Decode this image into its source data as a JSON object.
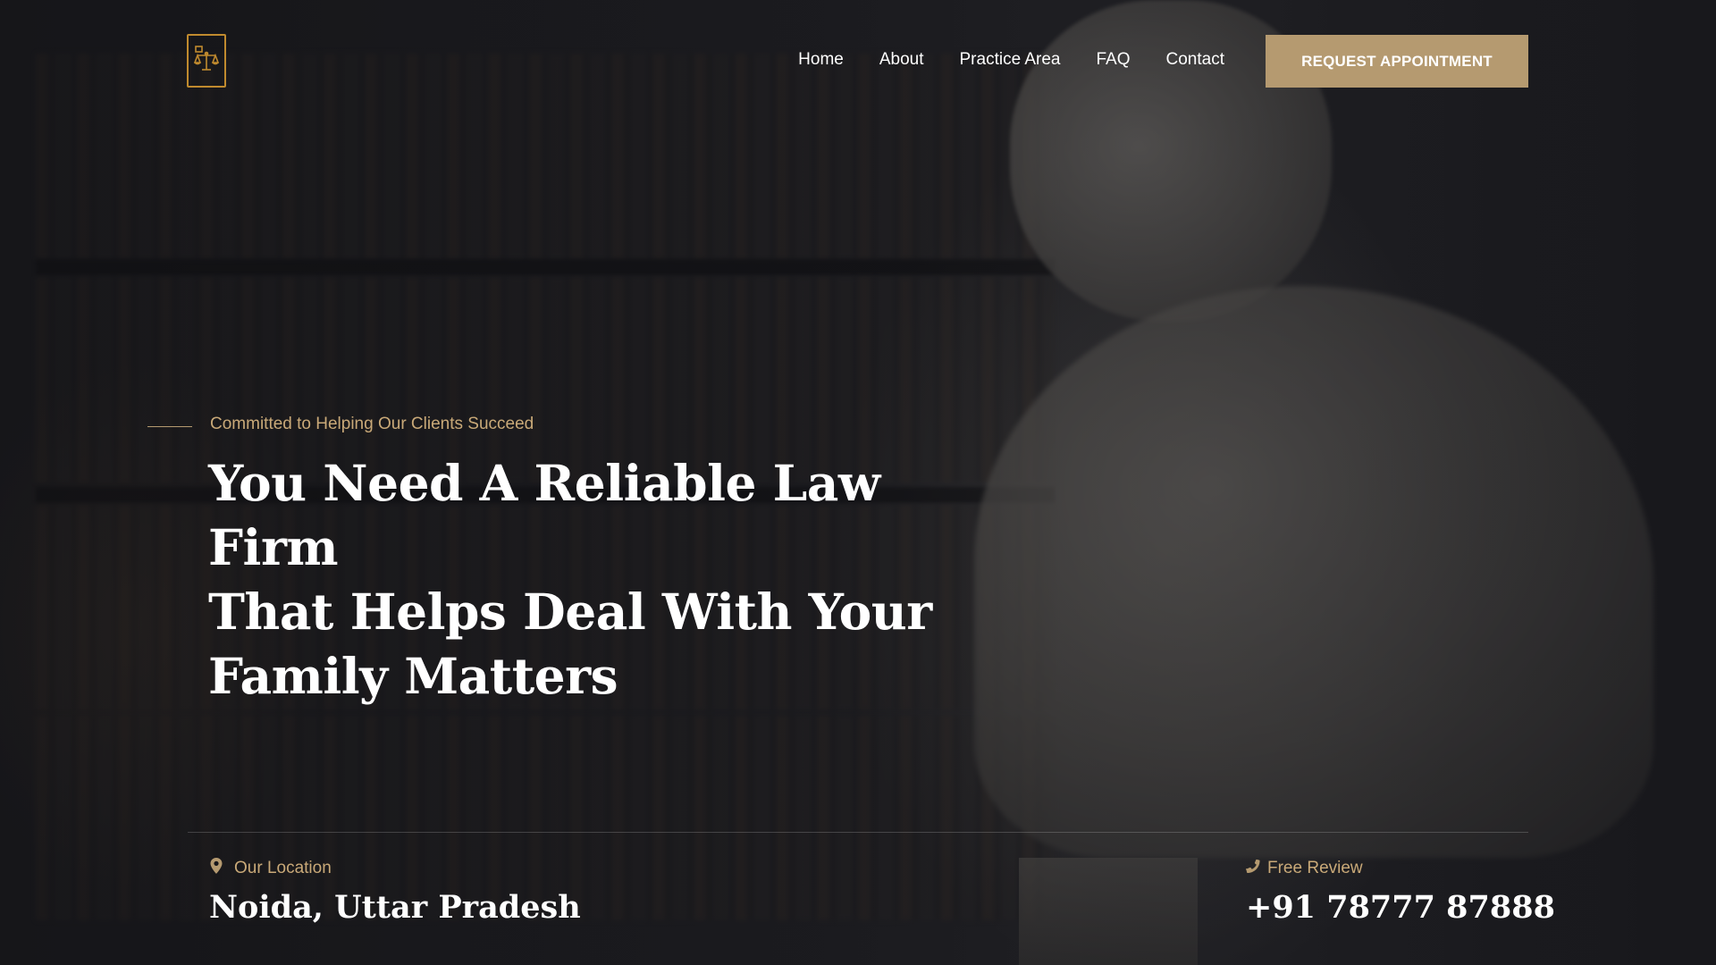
{
  "header": {
    "logo_icon": "scales-of-justice-icon",
    "nav": [
      {
        "label": "Home"
      },
      {
        "label": "About"
      },
      {
        "label": "Practice Area"
      },
      {
        "label": "FAQ"
      },
      {
        "label": "Contact"
      }
    ],
    "cta_label": "REQUEST APPOINTMENT"
  },
  "hero": {
    "tagline": "Committed to Helping Our Clients Succeed",
    "headline_lines": [
      "You Need A Reliable Law Firm",
      "That Helps Deal With Your",
      "Family Matters"
    ]
  },
  "info": {
    "location": {
      "icon": "map-pin-icon",
      "label": "Our Location",
      "value": "Noida, Uttar Pradesh"
    },
    "review": {
      "icon": "phone-icon",
      "label": "Free Review",
      "value": "+91 78777 87888"
    }
  },
  "colors": {
    "accent": "#b59a70",
    "accent_text": "#c9a978",
    "logo": "#c08a2e",
    "background": "#16171b",
    "text": "#ffffff"
  }
}
